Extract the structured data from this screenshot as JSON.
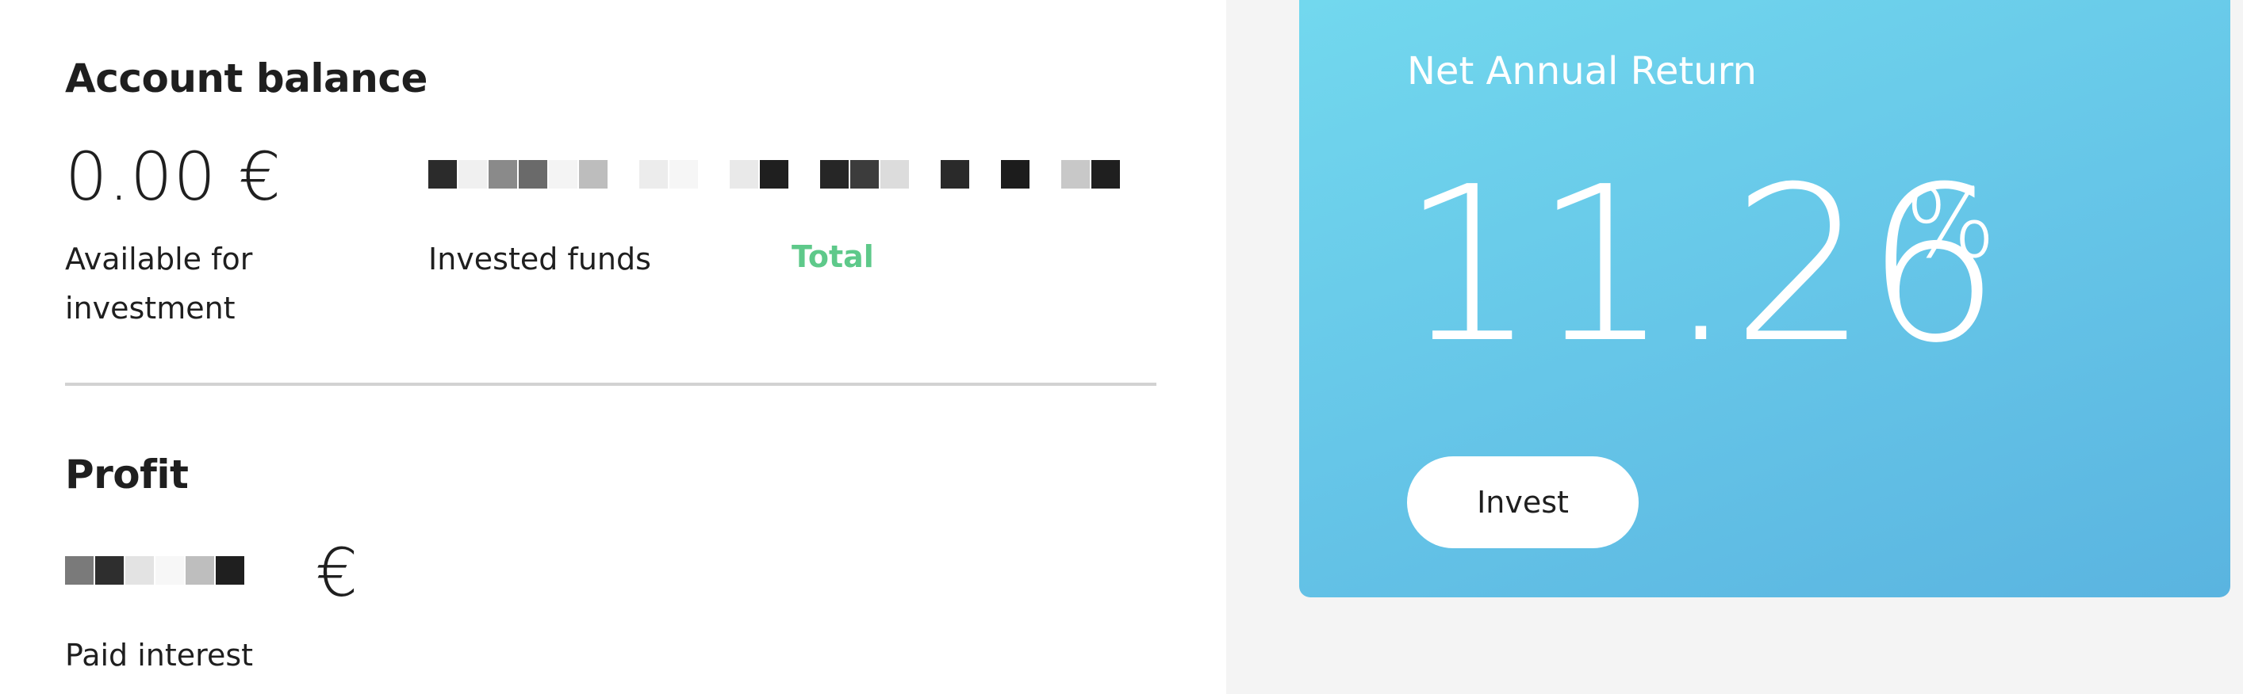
{
  "account_balance": {
    "heading": "Account balance",
    "available": {
      "amount": "0.00 €",
      "label_line1": "Available for",
      "label_line2": "investment"
    },
    "invested": {
      "label": "Invested funds"
    },
    "total_link": "Total"
  },
  "profit": {
    "heading": "Profit",
    "euro_sign": "€",
    "label": "Paid interest"
  },
  "net_return": {
    "title": "Net Annual Return",
    "value": "11.26",
    "unit": "%",
    "invest_button": "Invest"
  },
  "colors": {
    "accent_green": "#5ec98a",
    "card_gradient_start": "#72d8ee",
    "card_gradient_end": "#5ab4e0",
    "side_background": "#f4f4f4"
  }
}
